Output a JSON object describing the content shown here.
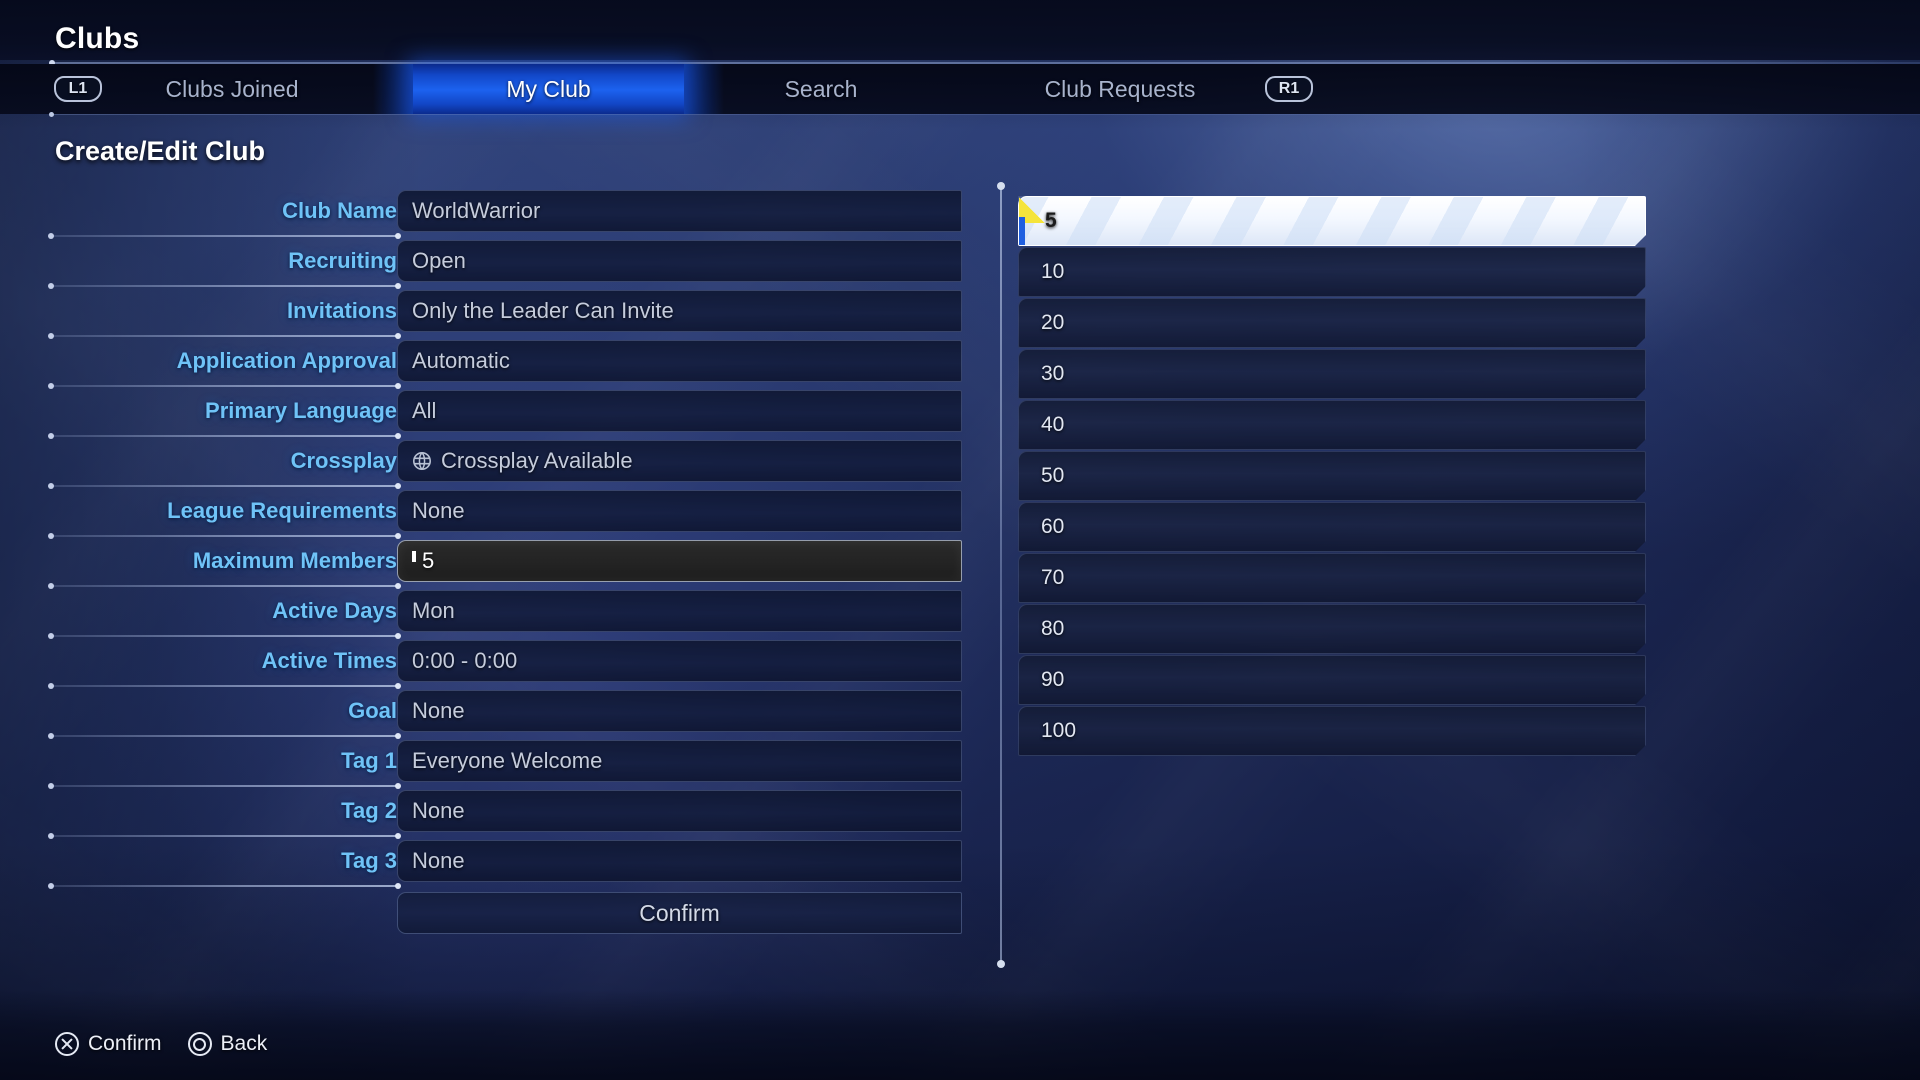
{
  "header": {
    "title": "Clubs"
  },
  "tabbar": {
    "left_bumper": "L1",
    "right_bumper": "R1",
    "tabs": [
      {
        "label": "Clubs Joined",
        "active": false
      },
      {
        "label": "My Club",
        "active": true
      },
      {
        "label": "Search",
        "active": false
      },
      {
        "label": "Club Requests",
        "active": false
      }
    ]
  },
  "section": {
    "heading": "Create/Edit Club"
  },
  "form": {
    "rows": [
      {
        "label": "Club Name",
        "value": "WorldWarrior",
        "selected": false,
        "icon": ""
      },
      {
        "label": "Recruiting",
        "value": "Open",
        "selected": false,
        "icon": ""
      },
      {
        "label": "Invitations",
        "value": "Only the Leader Can Invite",
        "selected": false,
        "icon": ""
      },
      {
        "label": "Application Approval",
        "value": "Automatic",
        "selected": false,
        "icon": ""
      },
      {
        "label": "Primary Language",
        "value": "All",
        "selected": false,
        "icon": ""
      },
      {
        "label": "Crossplay",
        "value": "Crossplay Available",
        "selected": false,
        "icon": "crossplay-icon"
      },
      {
        "label": "League Requirements",
        "value": "None",
        "selected": false,
        "icon": ""
      },
      {
        "label": "Maximum Members",
        "value": "5",
        "selected": true,
        "icon": ""
      },
      {
        "label": "Active Days",
        "value": "Mon",
        "selected": false,
        "icon": ""
      },
      {
        "label": "Active Times",
        "value": "0:00 - 0:00",
        "selected": false,
        "icon": ""
      },
      {
        "label": "Goal",
        "value": "None",
        "selected": false,
        "icon": ""
      },
      {
        "label": "Tag 1",
        "value": "Everyone Welcome",
        "selected": false,
        "icon": ""
      },
      {
        "label": "Tag 2",
        "value": "None",
        "selected": false,
        "icon": ""
      },
      {
        "label": "Tag 3",
        "value": "None",
        "selected": false,
        "icon": ""
      }
    ],
    "confirm_label": "Confirm"
  },
  "option_list": {
    "name": "maximum-members-options",
    "options": [
      {
        "label": "5",
        "highlighted": true
      },
      {
        "label": "10",
        "highlighted": false
      },
      {
        "label": "20",
        "highlighted": false
      },
      {
        "label": "30",
        "highlighted": false
      },
      {
        "label": "40",
        "highlighted": false
      },
      {
        "label": "50",
        "highlighted": false
      },
      {
        "label": "60",
        "highlighted": false
      },
      {
        "label": "70",
        "highlighted": false
      },
      {
        "label": "80",
        "highlighted": false
      },
      {
        "label": "90",
        "highlighted": false
      },
      {
        "label": "100",
        "highlighted": false
      }
    ]
  },
  "footer": {
    "prompts": [
      {
        "button": "cross",
        "icon": "cross-button-icon",
        "label": "Confirm"
      },
      {
        "button": "circle",
        "icon": "circle-button-icon",
        "label": "Back"
      }
    ]
  },
  "colors": {
    "label_blue": "#6fc3f7",
    "tab_active_blue": "#1c62ef",
    "highlight_yellow": "#f5e43c",
    "highlight_edge_blue": "#1f5fe0",
    "background_blue": "#2b3d74"
  }
}
